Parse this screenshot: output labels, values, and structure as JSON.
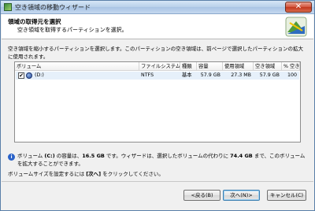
{
  "window": {
    "title": "空き領域の移動ウィザード",
    "close_glyph": "✕"
  },
  "header": {
    "title": "領域の取得元を選択",
    "subtitle": "空き領域を取得するパーティションを選択。",
    "logo_icon": "wizard-logo-icon"
  },
  "instruction": "空き領域を縮小するパーティションを選択します。このパーティションの空き領域は、前ページで選択したパーティションの拡大に使用されます。",
  "table": {
    "columns": [
      "ボリューム",
      "ファイルシステム",
      "種類",
      "容量",
      "使用領域",
      "空き領域",
      "% 空き"
    ],
    "rows": [
      {
        "checked": "✔",
        "volume": "(D:)",
        "filesystem": "NTFS",
        "type": "基本",
        "capacity": "57.9 GB",
        "used": "27.3 MB",
        "free": "57.9 GB",
        "percent_free": "100"
      }
    ]
  },
  "info": {
    "icon_glyph": "i",
    "p1": "ボリューム ",
    "vol": "(C:)",
    "p2": " の容量は、",
    "size": "16.5 GB",
    "p3": " です。ウィザードは、選択したボリュームの代わりに ",
    "amount": "74.4 GB",
    "p4": " まで、このボリュームを拡大することができます。"
  },
  "footer": {
    "p1": "ボリュームサイズを設定するには ",
    "next_ref": "[次へ]",
    "p2": " をクリックしてください。"
  },
  "buttons": {
    "back": "<戻る(B)",
    "next": "次へ(N)>",
    "cancel": "キャンセル(C)"
  }
}
